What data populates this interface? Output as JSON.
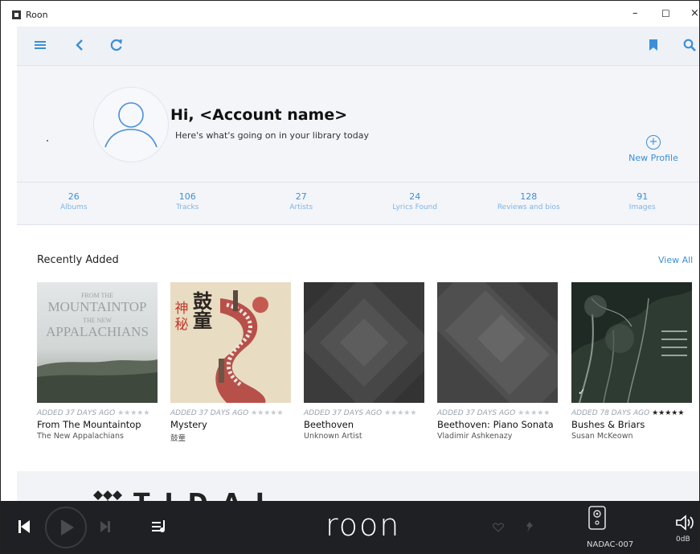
{
  "window": {
    "title": "Roon"
  },
  "profile": {
    "greeting": "Hi, <Account name>",
    "subtitle": "Here's what's going on in your library today",
    "new_profile_label": "New Profile"
  },
  "stats": [
    {
      "value": "26",
      "label": "Albums"
    },
    {
      "value": "106",
      "label": "Tracks"
    },
    {
      "value": "27",
      "label": "Artists"
    },
    {
      "value": "24",
      "label": "Lyrics Found"
    },
    {
      "value": "128",
      "label": "Reviews and bios"
    },
    {
      "value": "91",
      "label": "Images"
    }
  ],
  "recently_added": {
    "title": "Recently Added",
    "view_all": "View All",
    "albums": [
      {
        "added": "ADDED 37 DAYS AGO",
        "stars": "★★★★★",
        "title": "From The Mountaintop",
        "artist": "The New Appalachians",
        "cover_text": [
          "FROM THE",
          "MOUNTAINTOP",
          "THE NEW",
          "APPALACHIANS"
        ]
      },
      {
        "added": "ADDED 37 DAYS AGO",
        "stars": "★★★★★",
        "title": "Mystery",
        "artist": "鼓童",
        "cover_text": [
          "鼓",
          "童",
          "神",
          "秘"
        ]
      },
      {
        "added": "ADDED 37 DAYS AGO",
        "stars": "★★★★★",
        "title": "Beethoven",
        "artist": "Unknown Artist"
      },
      {
        "added": "ADDED 37 DAYS AGO",
        "stars": "★★★★★",
        "title": "Beethoven: Piano Sonata",
        "artist": "Vladimir Ashkenazy"
      },
      {
        "added": "ADDED 78 DAYS AGO",
        "stars": "★★★★★",
        "title": "Bushes & Briars",
        "artist": "Susan McKeown"
      }
    ]
  },
  "banner": {
    "logo": "TIDAL"
  },
  "player": {
    "logo": "roon",
    "zone": "NADAC-007",
    "volume": "0dB"
  },
  "colors": {
    "accent": "#3c8fd8",
    "player_bg": "#1f2024",
    "hero_bg": "#f3f5f9"
  }
}
